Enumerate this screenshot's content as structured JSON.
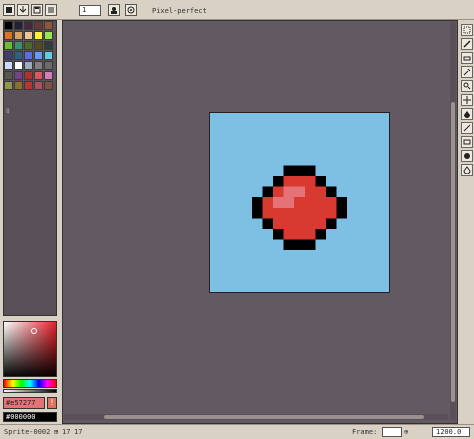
{
  "toolbar": {
    "zoom_value": "1",
    "mode_label": "Pixel-perfect",
    "buttons": [
      "new-icon",
      "open-icon",
      "save-icon",
      "menu-icon",
      "zoom-icon",
      "user-icon",
      "target-icon"
    ]
  },
  "palette": {
    "index_label": "8",
    "colors": [
      "#000000",
      "#222034",
      "#45283c",
      "#663931",
      "#8f563b",
      "#df7126",
      "#d9a066",
      "#eec39a",
      "#fbf236",
      "#99e550",
      "#6abe30",
      "#37946e",
      "#4b692f",
      "#524b24",
      "#323c39",
      "#3f3f74",
      "#306082",
      "#5b6ee1",
      "#639bff",
      "#5fcde4",
      "#cbdbfc",
      "#ffffff",
      "#9badb7",
      "#847e87",
      "#696a6a",
      "#595652",
      "#76428a",
      "#ac3232",
      "#d95763",
      "#d77bba",
      "#8f974a",
      "#8a6f30",
      "#bb3333",
      "#b05060",
      "#805040"
    ]
  },
  "color_picker": {
    "hex_value": "#e57277",
    "secondary_value": "#000000",
    "hue": "#ff0000"
  },
  "canvas": {
    "background": "#7ec0e4",
    "workspace": "#635962"
  },
  "status": {
    "sprite_name": "Sprite-0002",
    "size_w": "17",
    "size_h": "17",
    "frame_label": "Frame:",
    "zoom_label": "1200.0"
  },
  "tools": [
    "marquee-icon",
    "pencil-icon",
    "eraser-icon",
    "eyedropper-icon",
    "zoom-icon",
    "move-icon",
    "fill-icon",
    "line-icon",
    "rectangle-icon",
    "ellipse-icon",
    "blur-icon"
  ]
}
